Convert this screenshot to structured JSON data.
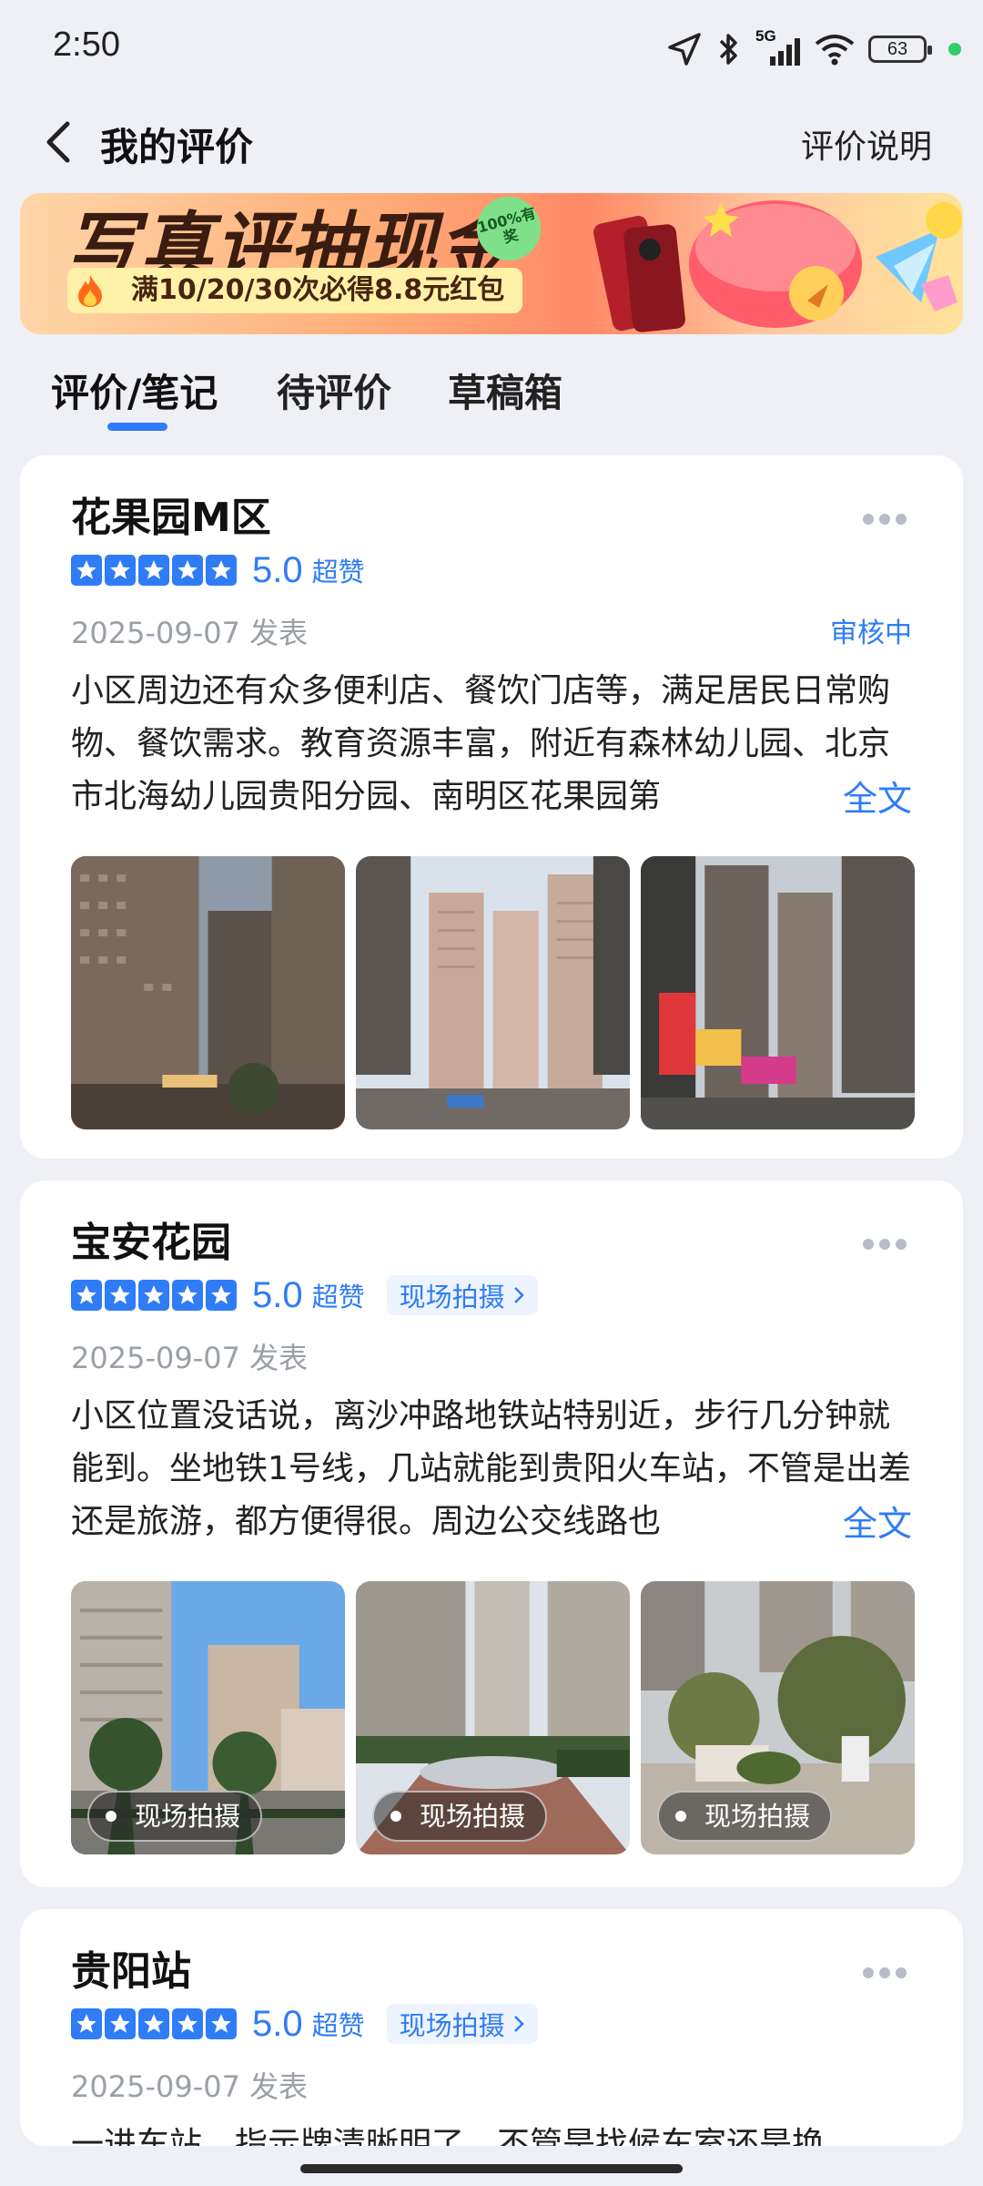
{
  "status_bar": {
    "time": "2:50",
    "network": "5G",
    "battery": "63"
  },
  "nav": {
    "title": "我的评价",
    "right_link": "评价说明"
  },
  "banner": {
    "title": "写真评抽现金",
    "badge": "100%有奖",
    "subtitle": "满10/20/30次必得8.8元红包"
  },
  "tabs": [
    {
      "label": "评价/笔记",
      "active": true
    },
    {
      "label": "待评价",
      "active": false
    },
    {
      "label": "草稿箱",
      "active": false
    }
  ],
  "reviews": [
    {
      "title": "花果园M区",
      "score": "5.0",
      "score_label": "超赞",
      "date": "2025-09-07 发表",
      "status": "审核中",
      "text": "小区周边还有众多便利店、餐饮门店等，满足居民日常购物、餐饮需求。教育资源丰富，附近有森林幼儿园、北京市北海幼儿园贵阳分园、南明区花果园第",
      "fulltext": "全文"
    },
    {
      "title": "宝安花园",
      "score": "5.0",
      "score_label": "超赞",
      "onsite_tag": "现场拍摄",
      "date": "2025-09-07 发表",
      "text": "小区位置没话说，离沙冲路地铁站特别近，步行几分钟就能到。坐地铁1号线，几站就能到贵阳火车站，不管是出差还是旅游，都方便得很。周边公交线路也",
      "fulltext": "全文",
      "photo_badge": "现场拍摄"
    },
    {
      "title": "贵阳站",
      "score": "5.0",
      "score_label": "超赞",
      "onsite_tag": "现场拍摄",
      "date": "2025-09-07 发表",
      "text": "一进车站，指示牌清晰明了，不管是找候车室还是换"
    }
  ]
}
